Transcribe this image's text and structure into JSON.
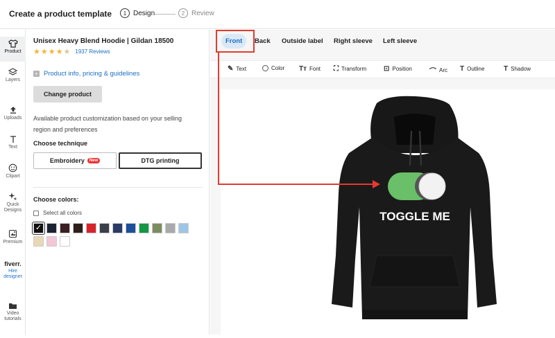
{
  "header": {
    "title": "Create a product template",
    "steps": [
      {
        "num": "1",
        "label": "Design"
      },
      {
        "num": "2",
        "label": "Review"
      }
    ]
  },
  "rail": {
    "items": [
      {
        "label": "Product",
        "icon": "tshirt-icon"
      },
      {
        "label": "Layers",
        "icon": "layers-icon"
      },
      {
        "label": "Uploads",
        "icon": "upload-icon"
      },
      {
        "label": "Text",
        "icon": "text-icon"
      },
      {
        "label": "Clipart",
        "icon": "smiley-icon"
      },
      {
        "label": "Quick Designs",
        "icon": "sparkle-icon"
      },
      {
        "label": "Premium",
        "icon": "premium-icon"
      },
      {
        "label": "Hire designer",
        "logo": "fiverr."
      },
      {
        "label": "Video tutorials",
        "icon": "folder-icon"
      }
    ]
  },
  "panel": {
    "product_name": "Unisex Heavy Blend Hoodie | Gildan 18500",
    "rating": 4.5,
    "reviews": "1937 Reviews",
    "info_link": "Product info, pricing & guidelines",
    "change_button": "Change product",
    "description": "Available product customization based on your selling region and preferences",
    "technique_label": "Choose technique",
    "techniques": [
      {
        "label": "Embroidery",
        "badge": "New"
      },
      {
        "label": "DTG printing"
      }
    ],
    "colors_label": "Choose colors:",
    "select_all": "Select all colors",
    "colors": [
      "#111111",
      "#1b2230",
      "#3a1f23",
      "#2d1f1c",
      "#d8232a",
      "#3a3f48",
      "#2a3b67",
      "#1c4f9c",
      "#139847",
      "#7d8c5e",
      "#a7a9ab",
      "#9fc6e4",
      "#e9d8b5",
      "#f3c6d8",
      "#ffffff"
    ]
  },
  "view_tabs": [
    "Front",
    "Back",
    "Outside label",
    "Right sleeve",
    "Left sleeve"
  ],
  "tools": [
    {
      "label": "Text",
      "icon": "edit-text-icon"
    },
    {
      "label": "Color",
      "icon": "color-circle-icon"
    },
    {
      "label": "Font",
      "icon": "font-icon"
    },
    {
      "label": "Transform",
      "icon": "transform-icon"
    },
    {
      "label": "Position",
      "icon": "position-icon"
    },
    {
      "label": "Arc",
      "icon": "arc-icon"
    },
    {
      "label": "Outline",
      "icon": "outline-icon"
    },
    {
      "label": "Shadow",
      "icon": "shadow-icon"
    }
  ],
  "design": {
    "toggle_text": "TOGGLE ME"
  },
  "colors": {
    "accent": "#1a6ec2",
    "highlight": "#e53a2f",
    "hoodie": "#1a1a1a",
    "toggle_green": "#6abf69"
  }
}
